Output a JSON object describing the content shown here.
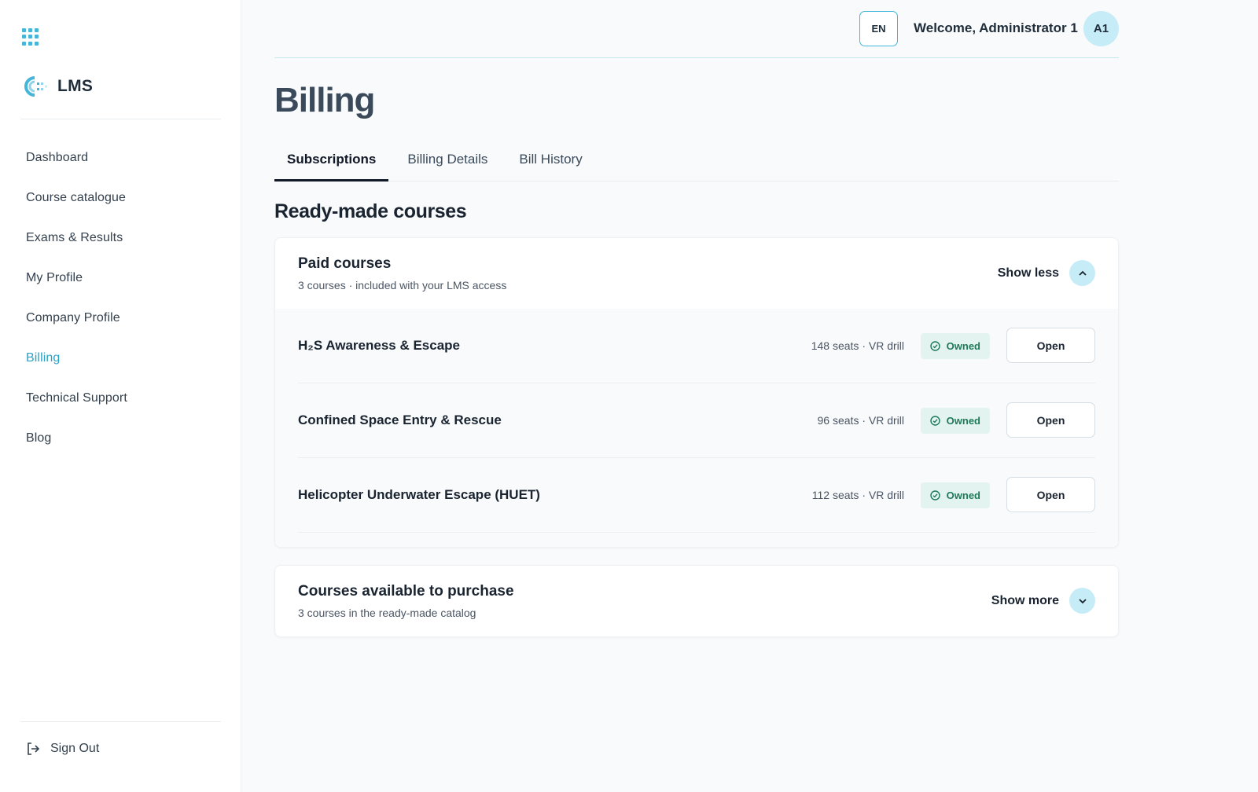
{
  "brand": {
    "name": "LMS",
    "accent": "#45b5d8"
  },
  "sidebar": {
    "items": [
      {
        "label": "Dashboard"
      },
      {
        "label": "Course catalogue"
      },
      {
        "label": "Exams & Results"
      },
      {
        "label": "My Profile"
      },
      {
        "label": "Company Profile"
      },
      {
        "label": "Billing",
        "active": true
      },
      {
        "label": "Technical Support"
      },
      {
        "label": "Blog"
      }
    ],
    "sign_out": "Sign Out"
  },
  "header": {
    "lang": "EN",
    "welcome": "Welcome, Administrator 1",
    "avatar_initials": "A1"
  },
  "page": {
    "title": "Billing",
    "tabs": [
      {
        "label": "Subscriptions",
        "active": true
      },
      {
        "label": "Billing Details"
      },
      {
        "label": "Bill History"
      }
    ],
    "section_title": "Ready-made courses"
  },
  "paid": {
    "title": "Paid courses",
    "subtitle": "3 courses · included with your LMS access",
    "toggle_label": "Show less",
    "toggle_icon": "chevron-up-icon",
    "courses": [
      {
        "name": "H₂S Awareness & Escape",
        "meta": "148 seats · VR drill",
        "status": "Owned",
        "action": "Open"
      },
      {
        "name": "Confined Space Entry & Rescue",
        "meta": "96 seats · VR drill",
        "status": "Owned",
        "action": "Open"
      },
      {
        "name": "Helicopter Underwater Escape (HUET)",
        "meta": "112 seats · VR drill",
        "status": "Owned",
        "action": "Open"
      }
    ]
  },
  "purchase": {
    "title": "Courses available to purchase",
    "subtitle": "3 courses in the ready-made catalog",
    "toggle_label": "Show more",
    "toggle_icon": "chevron-down-icon"
  },
  "colors": {
    "accent": "#45b5d8",
    "active_nav": "#2aa3c9",
    "owned_badge_bg": "#e3f3ef",
    "owned_badge_text": "#1f7a5a",
    "avatar_bg": "#c6ecf7"
  }
}
